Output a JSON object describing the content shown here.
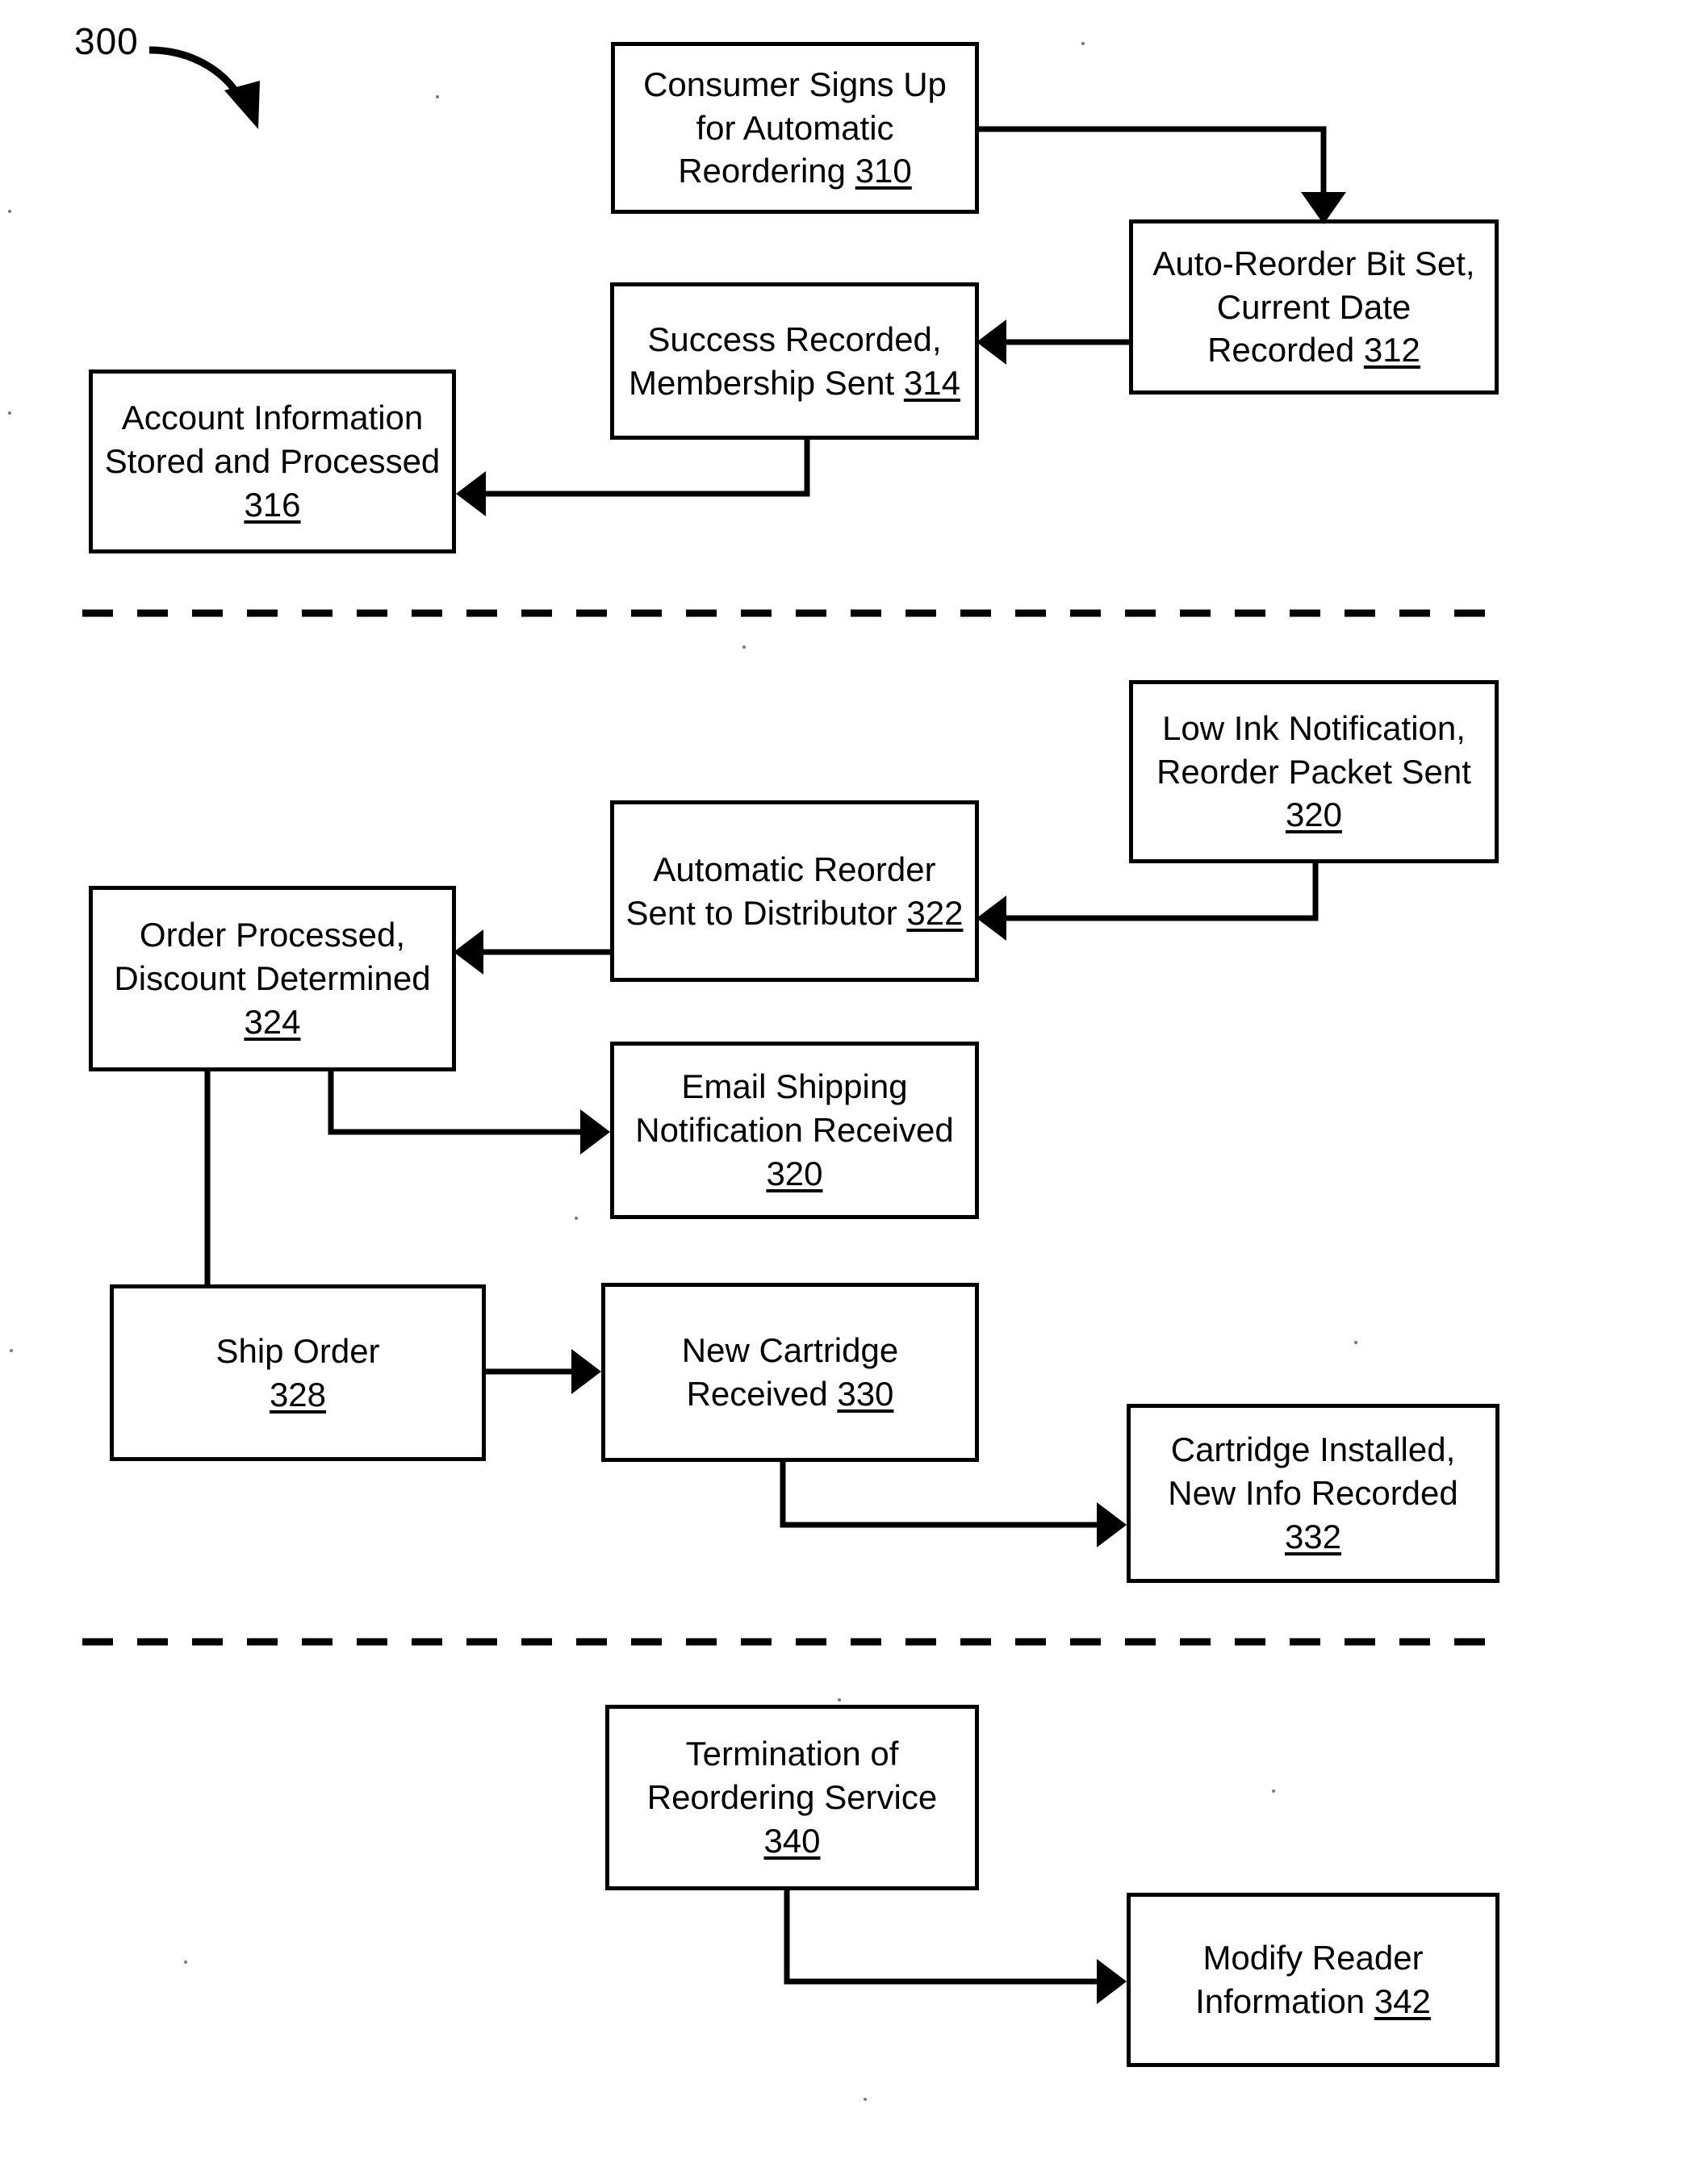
{
  "figure": {
    "label": "300",
    "title_note": "Patent flowchart figure 300",
    "background_color": "#ffffff",
    "line_color": "#000000"
  },
  "sections": [
    {
      "name": "signup",
      "divider_after": true
    },
    {
      "name": "reorder-cycle",
      "divider_after": true
    },
    {
      "name": "termination",
      "divider_after": false
    }
  ],
  "nodes": [
    {
      "id": "310",
      "name": "consumer-signs-up",
      "lines": [
        "Consumer Signs Up",
        "for Automatic",
        "Reordering "
      ],
      "number": "310",
      "number_on_line": 2
    },
    {
      "id": "312",
      "name": "auto-reorder-bit-set",
      "lines": [
        "Auto-Reorder Bit Set,",
        "Current Date",
        "Recorded "
      ],
      "number": "312",
      "number_on_line": 2
    },
    {
      "id": "314",
      "name": "success-recorded",
      "lines": [
        "Success Recorded,",
        "Membership Sent "
      ],
      "number": "314",
      "number_on_line": 1
    },
    {
      "id": "316",
      "name": "account-information-stored",
      "lines": [
        "Account Information",
        "Stored and Processed",
        ""
      ],
      "number": "316",
      "number_on_line": 2
    },
    {
      "id": "320a",
      "name": "low-ink-notification",
      "lines": [
        "Low Ink Notification,",
        "Reorder Packet Sent",
        ""
      ],
      "number": "320",
      "number_on_line": 2
    },
    {
      "id": "322",
      "name": "automatic-reorder-sent",
      "lines": [
        "Automatic Reorder",
        "Sent to Distributor "
      ],
      "number": "322",
      "number_on_line": 1
    },
    {
      "id": "324",
      "name": "order-processed-discount",
      "lines": [
        "Order Processed,",
        "Discount Determined",
        ""
      ],
      "number": "324",
      "number_on_line": 2
    },
    {
      "id": "320b",
      "name": "email-shipping-notification",
      "lines": [
        "Email Shipping",
        "Notification Received",
        ""
      ],
      "number": "320",
      "number_on_line": 2
    },
    {
      "id": "328",
      "name": "ship-order",
      "lines": [
        "Ship Order",
        ""
      ],
      "number": "328",
      "number_on_line": 1
    },
    {
      "id": "330",
      "name": "new-cartridge-received",
      "lines": [
        "New Cartridge",
        "Received "
      ],
      "number": "330",
      "number_on_line": 1
    },
    {
      "id": "332",
      "name": "cartridge-installed",
      "lines": [
        "Cartridge Installed,",
        "New Info Recorded",
        ""
      ],
      "number": "332",
      "number_on_line": 2
    },
    {
      "id": "340",
      "name": "termination-of-reordering-service",
      "lines": [
        "Termination of",
        "Reordering Service",
        ""
      ],
      "number": "340",
      "number_on_line": 2
    },
    {
      "id": "342",
      "name": "modify-reader-information",
      "lines": [
        "Modify Reader",
        "Information  "
      ],
      "number": "342",
      "number_on_line": 1
    }
  ],
  "edges": [
    {
      "from": "310",
      "to": "312",
      "name": "edge-310-to-312"
    },
    {
      "from": "312",
      "to": "314",
      "name": "edge-312-to-314"
    },
    {
      "from": "314",
      "to": "316",
      "name": "edge-314-to-316"
    },
    {
      "from": "320a",
      "to": "322",
      "name": "edge-320-to-322"
    },
    {
      "from": "322",
      "to": "324",
      "name": "edge-322-to-324"
    },
    {
      "from": "324",
      "to": "320b",
      "name": "edge-324-to-email-320"
    },
    {
      "from": "324",
      "to": "328",
      "name": "edge-324-to-328"
    },
    {
      "from": "328",
      "to": "330",
      "name": "edge-328-to-330"
    },
    {
      "from": "330",
      "to": "332",
      "name": "edge-330-to-332"
    },
    {
      "from": "340",
      "to": "342",
      "name": "edge-340-to-342"
    }
  ]
}
